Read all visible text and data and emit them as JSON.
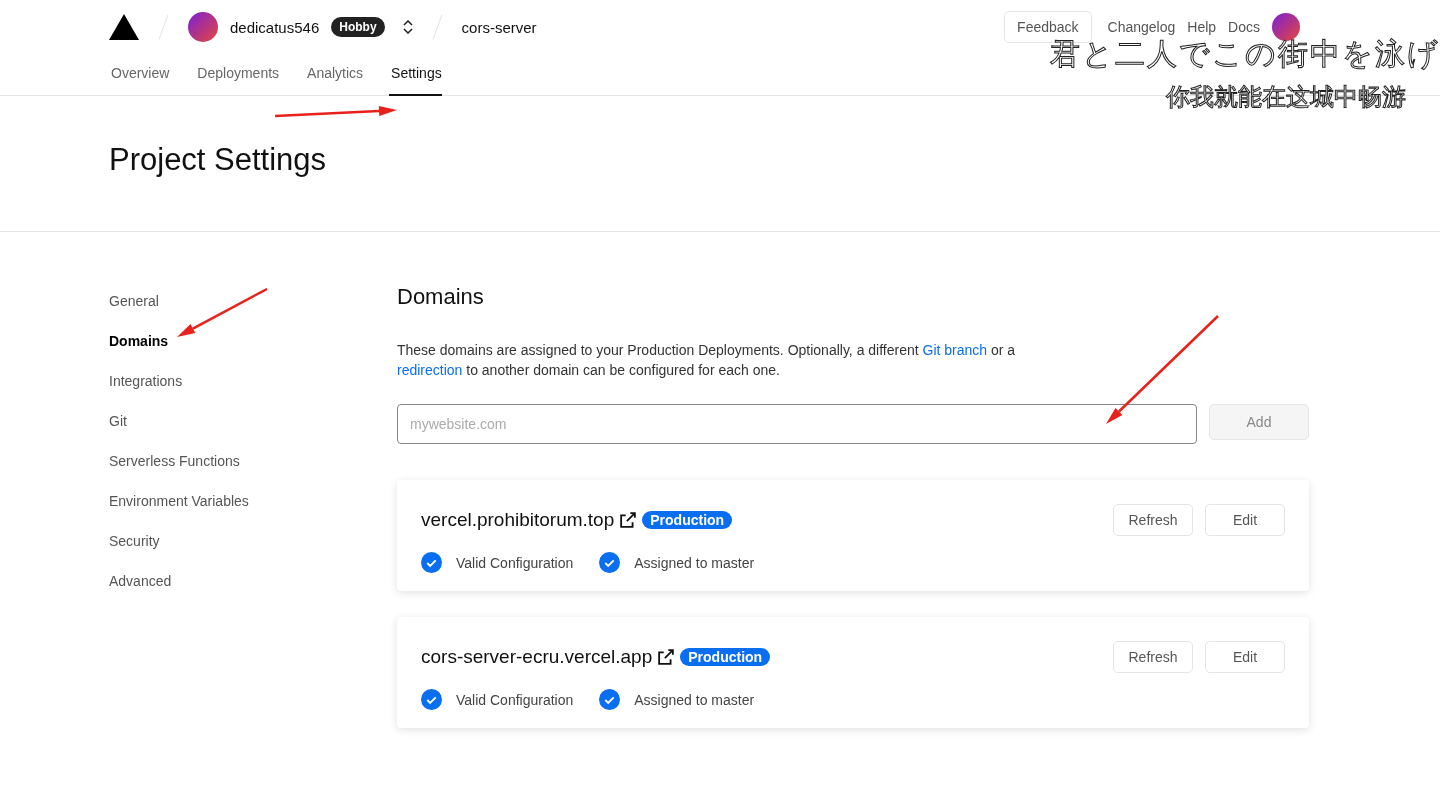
{
  "header": {
    "team": {
      "name": "dedicatus546",
      "plan": "Hobby"
    },
    "project": "cors-server",
    "links": [
      {
        "label": "Feedback",
        "kind": "button"
      },
      {
        "label": "Changelog",
        "kind": "link"
      },
      {
        "label": "Help",
        "kind": "link"
      },
      {
        "label": "Docs",
        "kind": "link"
      }
    ],
    "tabs": [
      {
        "label": "Overview",
        "selected": false
      },
      {
        "label": "Deployments",
        "selected": false
      },
      {
        "label": "Analytics",
        "selected": false
      },
      {
        "label": "Settings",
        "selected": true
      }
    ]
  },
  "page_title": "Project Settings",
  "sidebar": {
    "items": [
      {
        "label": "General",
        "selected": false
      },
      {
        "label": "Domains",
        "selected": true
      },
      {
        "label": "Integrations",
        "selected": false
      },
      {
        "label": "Git",
        "selected": false
      },
      {
        "label": "Serverless Functions",
        "selected": false
      },
      {
        "label": "Environment Variables",
        "selected": false
      },
      {
        "label": "Security",
        "selected": false
      },
      {
        "label": "Advanced",
        "selected": false
      }
    ]
  },
  "domains": {
    "title": "Domains",
    "description": [
      {
        "kind": "text",
        "text": "These domains are assigned to your Production Deployments. Optionally, a different "
      },
      {
        "kind": "link",
        "text": "Git branch"
      },
      {
        "kind": "text",
        "text": " or a "
      },
      {
        "kind": "link",
        "text": "redirection"
      },
      {
        "kind": "text",
        "text": " to another domain can be configured for each one."
      }
    ],
    "add_form": {
      "placeholder": "mywebsite.com",
      "button": "Add",
      "button_disabled": true
    },
    "items": [
      {
        "name": "vercel.prohibitorum.top",
        "badge": "Production",
        "checks": [
          {
            "label": "Valid Configuration",
            "checked": true
          },
          {
            "label": "Assigned to master",
            "checked": true
          }
        ],
        "buttons": [
          "Refresh",
          "Edit"
        ]
      },
      {
        "name": "cors-server-ecru.vercel.app",
        "badge": "Production",
        "checks": [
          {
            "label": "Valid Configuration",
            "checked": true
          },
          {
            "label": "Assigned to master",
            "checked": true
          }
        ],
        "buttons": [
          "Refresh",
          "Edit"
        ]
      }
    ]
  },
  "captions": [
    "君と二人でこの街中を泳げ",
    "你我就能在这城中畅游"
  ]
}
